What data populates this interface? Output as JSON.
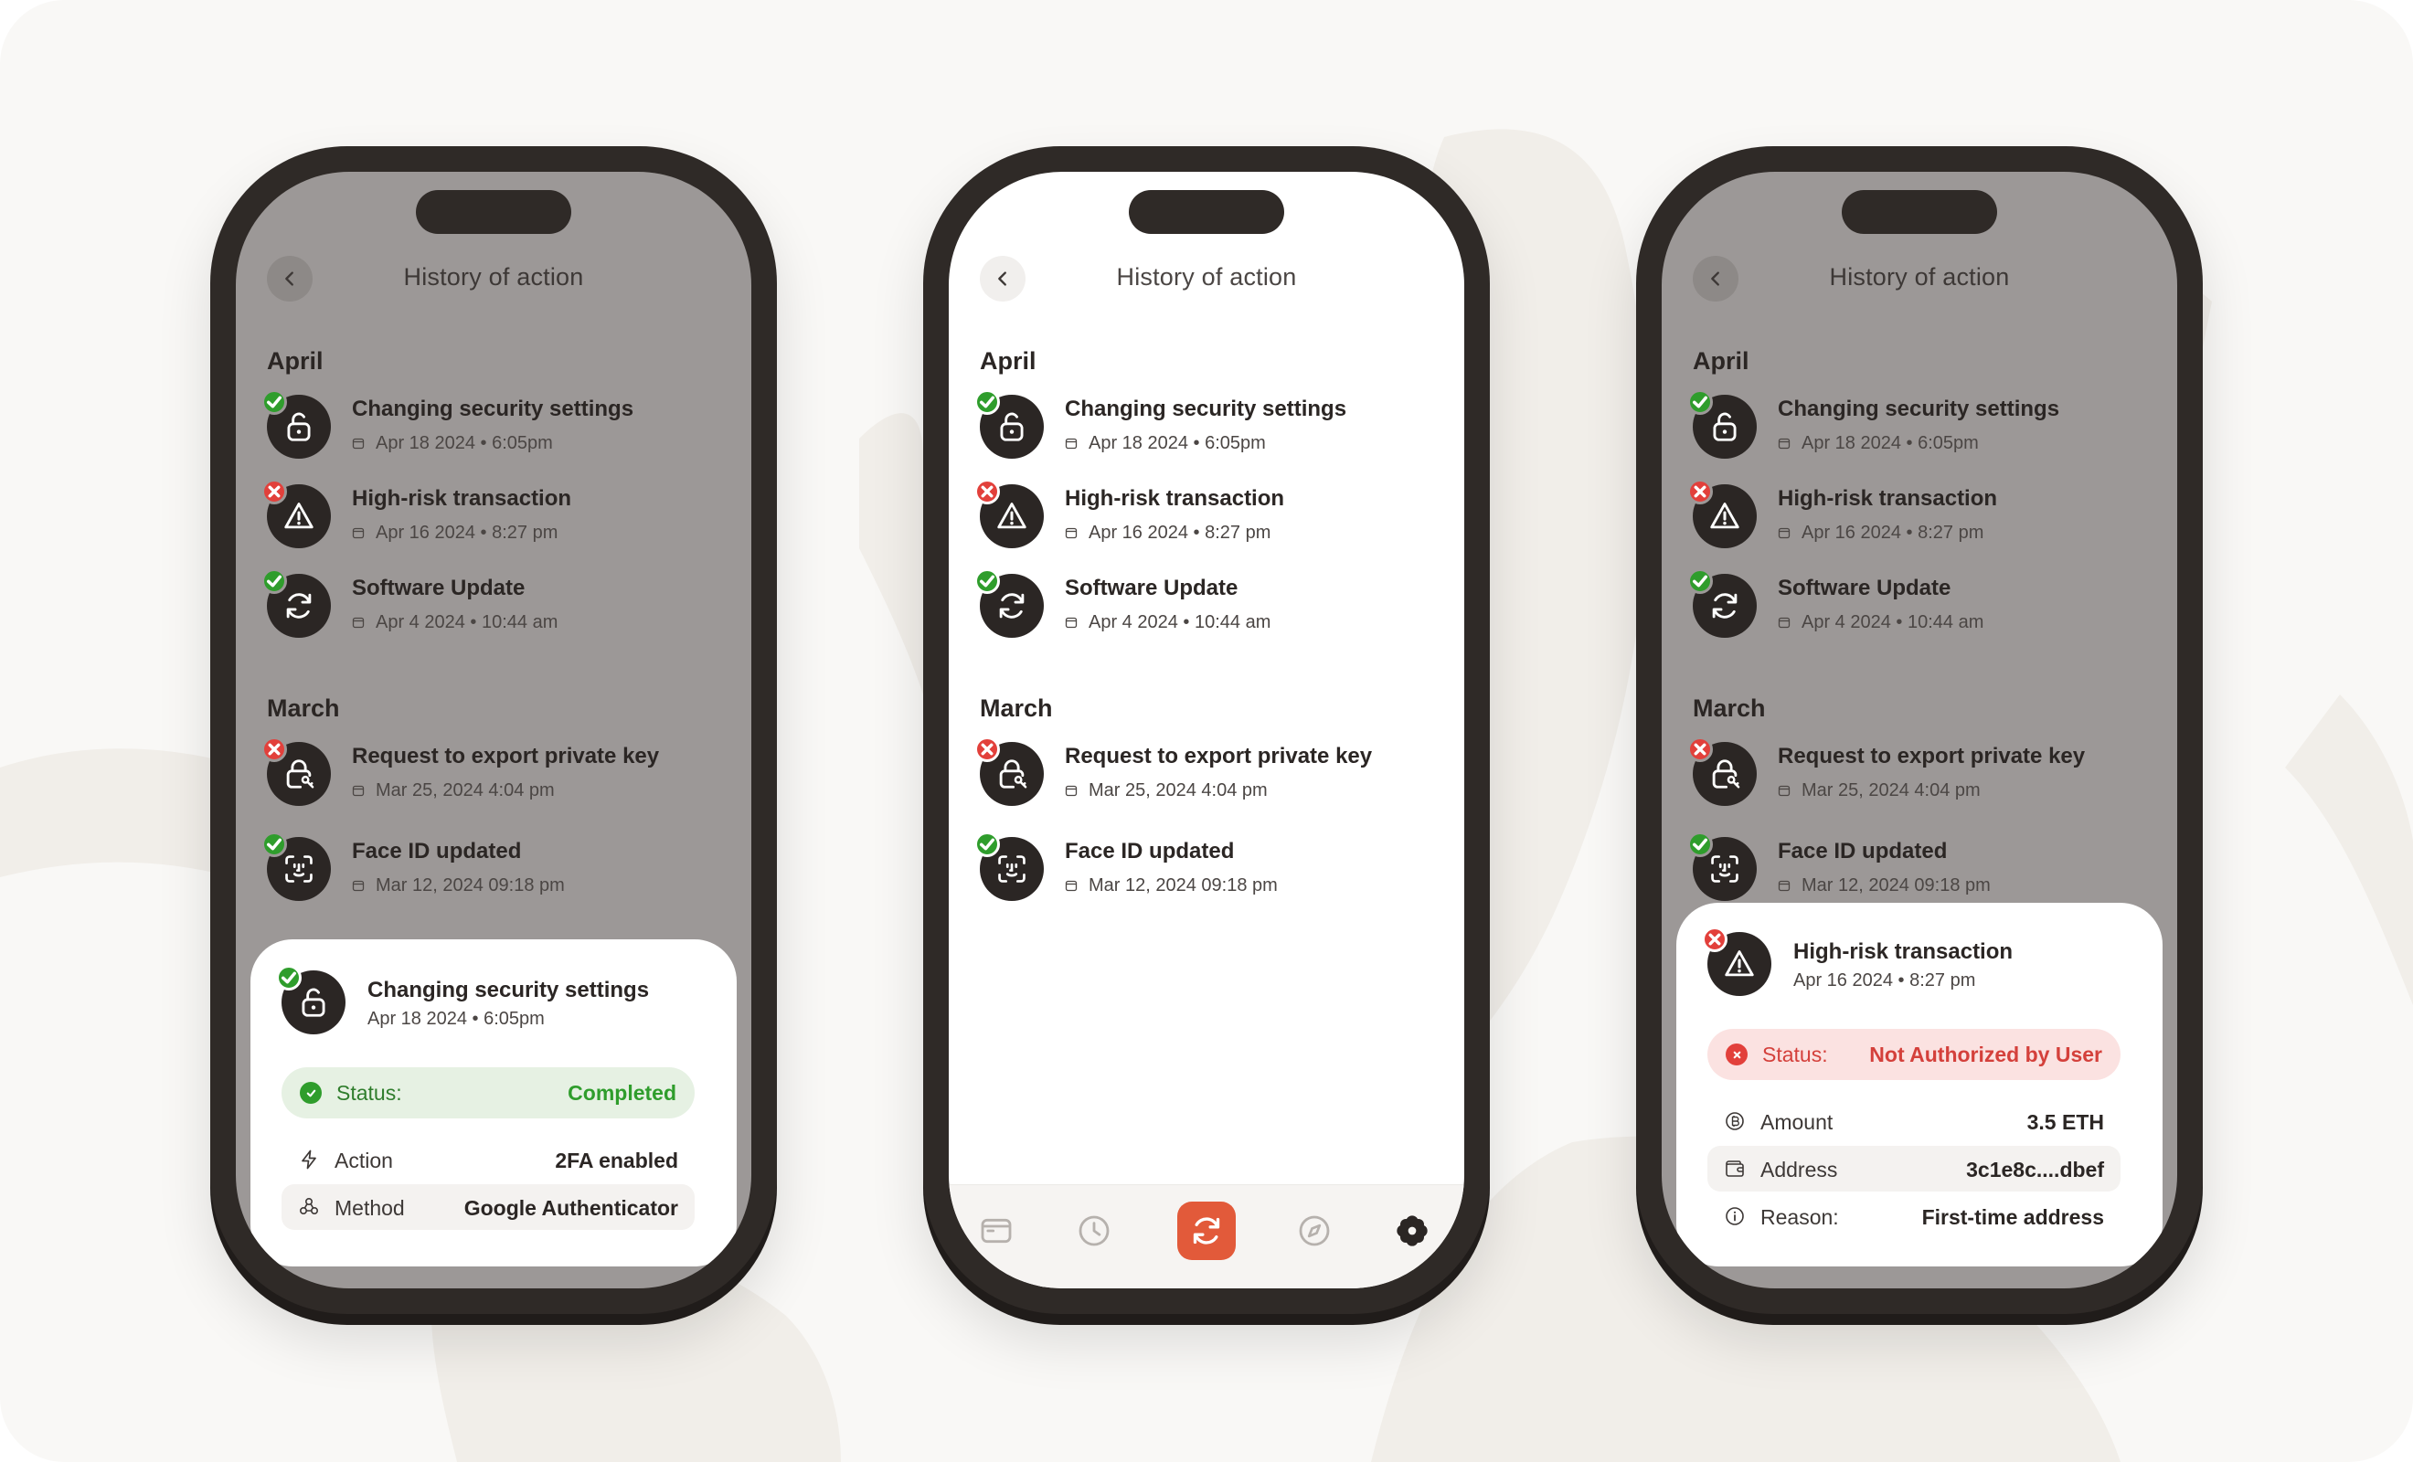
{
  "header": {
    "title": "History of action"
  },
  "sections": [
    {
      "title": "April",
      "items": [
        {
          "name": "Changing security settings",
          "date": "Apr 18 2024 • 6:05pm",
          "status": "ok",
          "icon": "unlock-icon"
        },
        {
          "name": "High-risk transaction",
          "date": "Apr 16 2024 • 8:27 pm",
          "status": "err",
          "icon": "warning-icon"
        },
        {
          "name": "Software Update",
          "date": "Apr 4 2024 • 10:44 am",
          "status": "ok",
          "icon": "refresh-icon"
        }
      ]
    },
    {
      "title": "March",
      "items": [
        {
          "name": "Request to export private key",
          "date": "Mar 25, 2024 4:04 pm",
          "status": "err",
          "icon": "lock-key-icon"
        },
        {
          "name": "Face ID updated",
          "date": "Mar 12, 2024 09:18 pm",
          "status": "ok",
          "icon": "face-id-icon"
        }
      ]
    }
  ],
  "sheet_completed": {
    "name": "Changing security settings",
    "date": "Apr 18 2024 • 6:05pm",
    "status_label": "Status:",
    "status_value": "Completed",
    "rows": [
      {
        "label": "Action",
        "value": "2FA enabled",
        "icon": "bolt-icon"
      },
      {
        "label": "Method",
        "value": "Google Authenticator",
        "icon": "shapes-icon"
      }
    ]
  },
  "sheet_failed": {
    "name": "High-risk transaction",
    "date": "Apr 16 2024 • 8:27 pm",
    "status_label": "Status:",
    "status_value": "Not Authorized by User",
    "rows": [
      {
        "label": "Amount",
        "value": "3.5 ETH",
        "icon": "coin-icon"
      },
      {
        "label": "Address",
        "value": "3c1e8c....dbef",
        "icon": "wallet-icon"
      },
      {
        "label": "Reason:",
        "value": "First-time address",
        "icon": "info-icon"
      }
    ]
  },
  "tabbar": [
    {
      "name": "wallet-tab",
      "icon": "card-icon",
      "active": false
    },
    {
      "name": "history-tab",
      "icon": "clock-icon",
      "active": false
    },
    {
      "name": "swap-tab",
      "icon": "refresh-icon",
      "active": true
    },
    {
      "name": "explore-tab",
      "icon": "compass-icon",
      "active": false
    },
    {
      "name": "settings-tab",
      "icon": "flower-icon",
      "active": false
    }
  ],
  "colors": {
    "success": "#2f9d2c",
    "error": "#e2403b",
    "accent": "#e25a3a",
    "phone_frame": "#2f2a27"
  }
}
